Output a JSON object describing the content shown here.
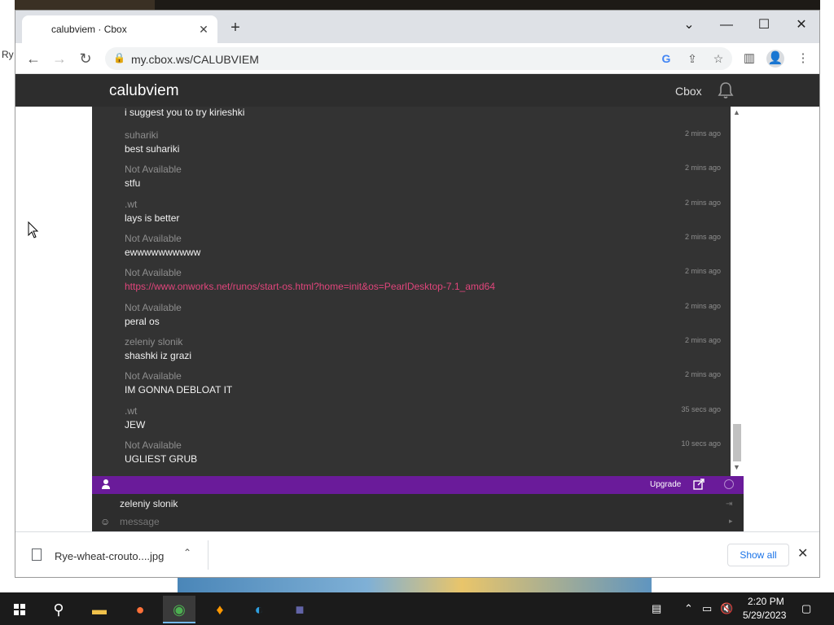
{
  "desktop": {
    "label": "Ry"
  },
  "tab": {
    "title": "calubviem · Cbox",
    "close": "✕",
    "new": "+"
  },
  "window_controls": {
    "dropdown": "⌄",
    "minimize": "—",
    "maximize": "☐",
    "close": "✕"
  },
  "toolbar": {
    "url": "my.cbox.ws/CALUBVIEM"
  },
  "page": {
    "title": "calubviem",
    "cbox_link": "Cbox"
  },
  "chat": {
    "messages": [
      {
        "user": "",
        "time": "",
        "text": "i suggest you to try kirieshki"
      },
      {
        "user": "suhariki",
        "time": "2 mins ago",
        "text": "best suhariki"
      },
      {
        "user": "Not Available",
        "time": "2 mins ago",
        "text": "stfu"
      },
      {
        "user": ".wt",
        "time": "2 mins ago",
        "text": "lays is better"
      },
      {
        "user": "Not Available",
        "time": "2 mins ago",
        "text": "ewwwwwwwwww"
      },
      {
        "user": "Not Available",
        "time": "2 mins ago",
        "text": "https://www.onworks.net/runos/start-os.html?home=init&os=PearlDesktop-7.1_amd64"
      },
      {
        "user": "Not Available",
        "time": "2 mins ago",
        "text": "peral os"
      },
      {
        "user": "zeleniy slonik",
        "time": "2 mins ago",
        "text": "shashki iz grazi"
      },
      {
        "user": "Not Available",
        "time": "2 mins ago",
        "text": "IM GONNA DEBLOAT IT"
      },
      {
        "user": ".wt",
        "time": "35 secs ago",
        "text": "JEW"
      },
      {
        "user": "Not Available",
        "time": "10 secs ago",
        "text": "UGLIEST GRUB"
      }
    ],
    "upgrade_label": "Upgrade",
    "name_value": "zeleniy slonik",
    "message_placeholder": "message"
  },
  "downloads": {
    "file_name": "Rye-wheat-crouto....jpg",
    "show_all": "Show all"
  },
  "clock": {
    "time": "2:20 PM",
    "date": "5/29/2023"
  },
  "colors": {
    "chat_bg": "#333333",
    "accent_purple": "#6a1b9a",
    "link_pink": "#e0457b"
  }
}
